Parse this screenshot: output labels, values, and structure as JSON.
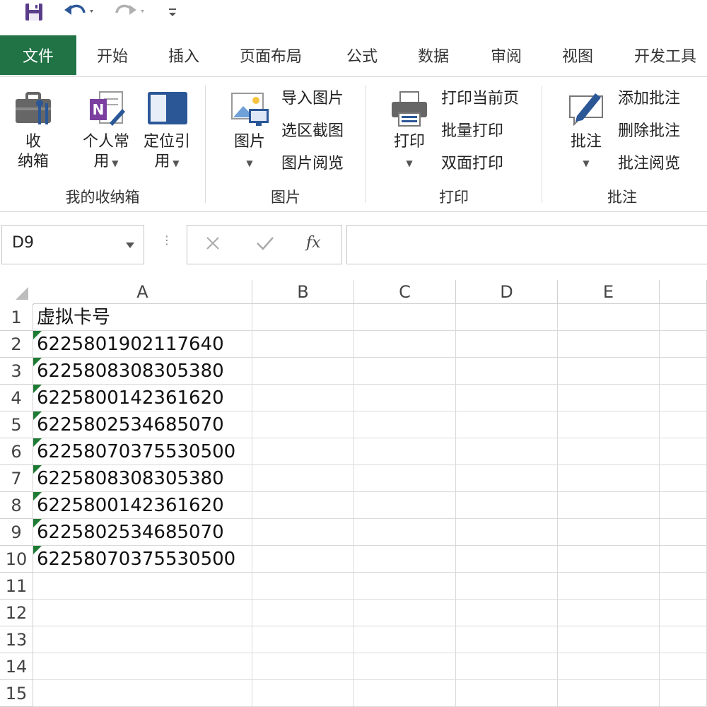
{
  "qat": {
    "icons": [
      "save-icon",
      "undo-icon",
      "redo-icon",
      "customize-icon"
    ]
  },
  "tabs": {
    "file": "文件",
    "items": [
      "开始",
      "插入",
      "页面布局",
      "公式",
      "数据",
      "审阅",
      "视图",
      "开发工具"
    ]
  },
  "ribbon": {
    "groups": [
      {
        "label": "我的收纳箱",
        "buttons": [
          {
            "label_l1": "收",
            "label_l2": "纳箱"
          },
          {
            "label_l1": "个人常",
            "label_l2": "用"
          },
          {
            "label_l1": "定位引",
            "label_l2": "用"
          }
        ]
      },
      {
        "label": "图片",
        "big": "图片",
        "small": [
          "导入图片",
          "选区截图",
          "图片阅览"
        ]
      },
      {
        "label": "打印",
        "big": "打印",
        "small": [
          "打印当前页",
          "批量打印",
          "双面打印"
        ]
      },
      {
        "label": "批注",
        "big": "批注",
        "small": [
          "添加批注",
          "删除批注",
          "批注阅览"
        ]
      }
    ]
  },
  "formula_bar": {
    "name_box": "D9",
    "fx_label": "fx",
    "formula": ""
  },
  "grid": {
    "columns": [
      "A",
      "B",
      "C",
      "D",
      "E"
    ],
    "rows": [
      "1",
      "2",
      "3",
      "4",
      "5",
      "6",
      "7",
      "8",
      "9",
      "10",
      "11",
      "12",
      "13",
      "14",
      "15"
    ],
    "column_a": [
      "虚拟卡号",
      "6225801902117640",
      "6225808308305380",
      "6225800142361620",
      "6225802534685070",
      "62258070375530500",
      "6225808308305380",
      "6225800142361620",
      "6225802534685070",
      "62258070375530500"
    ],
    "text_number_flag_color": "#1e7b34"
  },
  "colors": {
    "file_tab": "#217346",
    "icon_blue": "#2b5797",
    "icon_purple": "#7b3fa0"
  }
}
